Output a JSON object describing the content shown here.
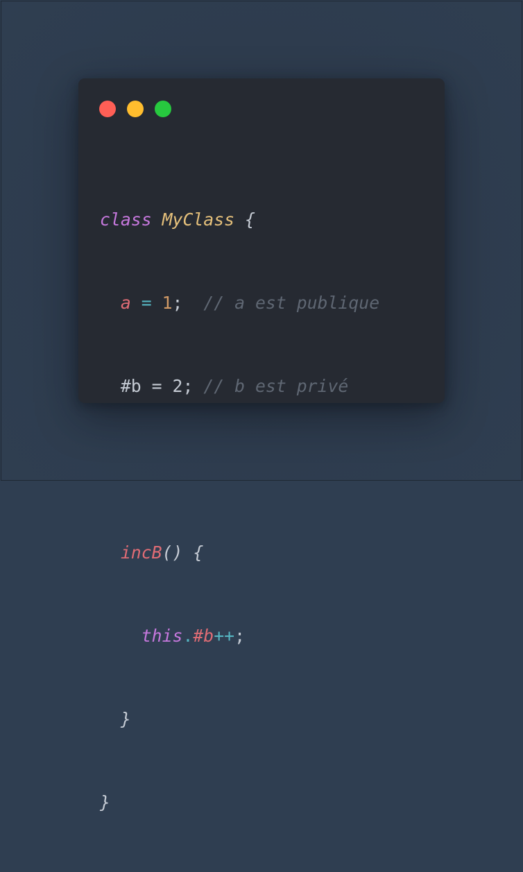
{
  "window": {
    "controls": {
      "close_color": "#ff5f56",
      "minimize_color": "#ffbd2e",
      "maximize_color": "#27c93f"
    }
  },
  "code": {
    "language": "javascript",
    "line1": {
      "keyword": "class",
      "class_name": "MyClass",
      "open_brace": "{"
    },
    "line2": {
      "indent": "  ",
      "prop": "a",
      "op": " = ",
      "number": "1",
      "semicolon": ";",
      "gap": "  ",
      "comment": "// a est publique"
    },
    "line3": {
      "indent": "  ",
      "priv_field": "#b",
      "op": " = ",
      "number": "2",
      "semicolon": ";",
      "gap": " ",
      "comment": "// b est privé"
    },
    "line4": {
      "text": ""
    },
    "line5": {
      "indent": "  ",
      "method": "incB",
      "parens": "()",
      "open_brace": "{"
    },
    "line6": {
      "indent": "    ",
      "this_kw": "this",
      "dot": ".",
      "priv_field": "#b",
      "op": "++",
      "semicolon": ";"
    },
    "line7": {
      "indent": "  ",
      "close_brace": "}"
    },
    "line8": {
      "close_brace": "}"
    }
  }
}
